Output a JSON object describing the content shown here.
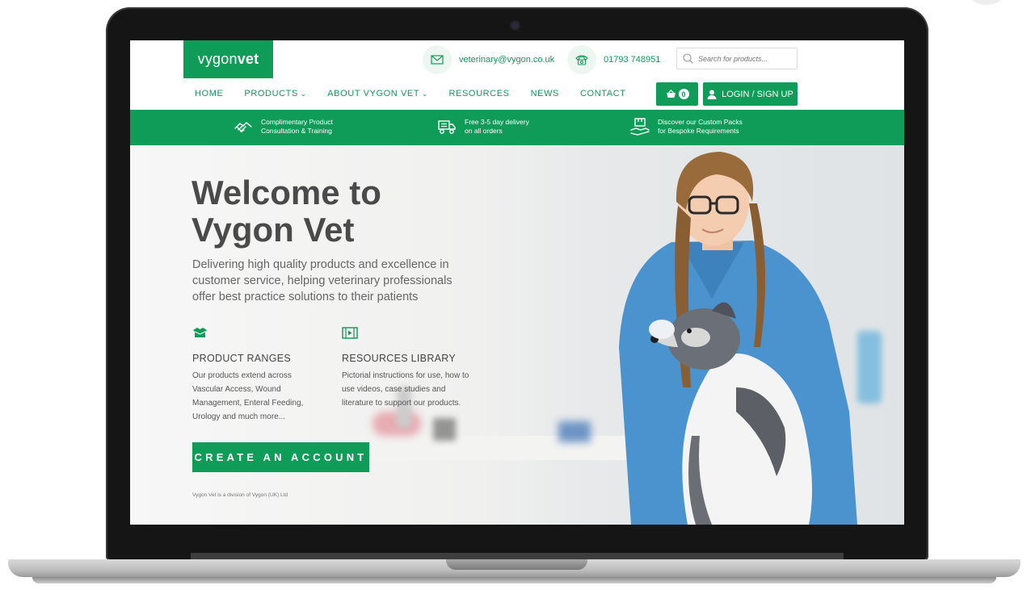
{
  "header": {
    "logo_light": "vygon",
    "logo_bold": "vet",
    "email": "veterinary@vygon.co.uk",
    "phone": "01793 748951",
    "search_placeholder": "Search for products..."
  },
  "nav": {
    "items": [
      {
        "label": "HOME",
        "dropdown": false
      },
      {
        "label": "PRODUCTS",
        "dropdown": true
      },
      {
        "label": "ABOUT VYGON VET",
        "dropdown": true
      },
      {
        "label": "RESOURCES",
        "dropdown": false
      },
      {
        "label": "NEWS",
        "dropdown": false
      },
      {
        "label": "CONTACT",
        "dropdown": false
      }
    ],
    "cart_count": "0",
    "login_label": "LOGIN / SIGN UP"
  },
  "features": [
    {
      "line1": "Complimentary Product",
      "line2": "Consultation & Training",
      "icon": "handshake-icon"
    },
    {
      "line1": "Free 3-5 day delivery",
      "line2": "on all orders",
      "icon": "delivery-truck-icon"
    },
    {
      "line1": "Discover our Custom Packs",
      "line2": "for Bespoke Requirements",
      "icon": "package-hand-icon"
    }
  ],
  "hero": {
    "title_line1": "Welcome to",
    "title_line2": "Vygon Vet",
    "subtitle": "Delivering high quality products and excellence in customer service, helping veterinary professionals offer best practice solutions to their patients",
    "columns": [
      {
        "icon": "open-box-icon",
        "title": "PRODUCT RANGES",
        "text": "Our products extend across Vascular Access, Wound Management, Enteral Feeding, Urology and much more..."
      },
      {
        "icon": "video-film-icon",
        "title": "RESOURCES LIBRARY",
        "text": "Pictorial instructions for use, how to use videos, case studies and literature to support our products."
      }
    ],
    "cta_label": "CREATE AN ACCOUNT",
    "footnote": "Vygon Vet is a division of Vygon (UK) Ltd"
  },
  "colors": {
    "brand_green": "#0f9b58",
    "heading_gray": "#4a4a4a"
  }
}
